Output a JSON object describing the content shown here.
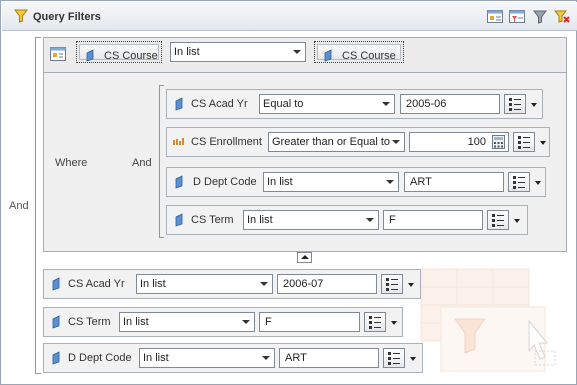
{
  "panel": {
    "title": "Query Filters"
  },
  "outer_operator": "And",
  "where_label": "Where",
  "inner_operator": "And",
  "group": {
    "left_field": "CS Course",
    "operator": "In list",
    "right_field": "CS Course"
  },
  "inner_filters": [
    {
      "field": "CS Acad Yr",
      "operator": "Equal to",
      "value": "2005-06"
    },
    {
      "field": "CS Enrollment",
      "operator": "Greater than or Equal to",
      "value": "100"
    },
    {
      "field": "D Dept Code",
      "operator": "In list",
      "value": "ART"
    },
    {
      "field": "CS Term",
      "operator": "In list",
      "value": "F"
    }
  ],
  "outer_filters": [
    {
      "field": "CS Acad Yr",
      "operator": "In list",
      "value": "2006-07"
    },
    {
      "field": "CS Term",
      "operator": "In list",
      "value": "F"
    },
    {
      "field": "D Dept Code",
      "operator": "In list",
      "value": "ART"
    }
  ],
  "icons": {
    "title": "funnel-icon",
    "toolbar": [
      "add-filter-icon",
      "add-subquery-icon",
      "filter-icon",
      "clear-filters-icon"
    ],
    "dimension": "dimension-object-icon",
    "measure": "measure-object-icon",
    "list_button": "value-list-icon",
    "calculator": "calculator-icon"
  },
  "colors": {
    "accent": "#5b8fd1",
    "measure": "#d68a2a",
    "titlebar": "#e3e7ec"
  }
}
